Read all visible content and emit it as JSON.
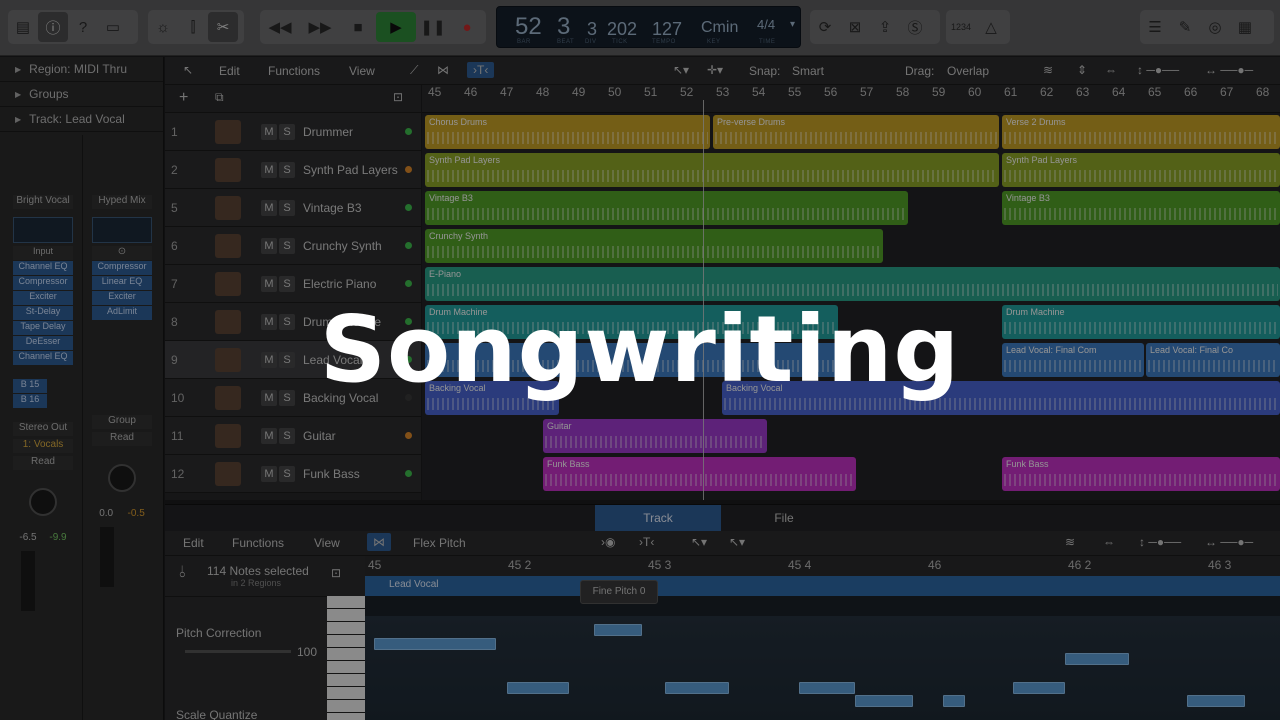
{
  "title": "Songwriting",
  "lcd": {
    "bar": "52",
    "beat": "3",
    "div": "3",
    "tick": "202",
    "tempo": "127",
    "key": "Cmin",
    "time": "4/4",
    "lbl_bar": "BAR",
    "lbl_beat": "BEAT",
    "lbl_div": "DIV",
    "lbl_tick": "TICK",
    "lbl_tempo": "TEMPO",
    "lbl_key": "KEY",
    "lbl_time": "TIME"
  },
  "ctrl": {
    "count_in": "1234"
  },
  "inspector": {
    "region": "Region:",
    "region_val": "MIDI Thru",
    "groups": "Groups",
    "track": "Track:",
    "track_val": "Lead Vocal",
    "strip1": {
      "name": "Bright Vocal",
      "input": "Input",
      "plugins": [
        "Channel EQ",
        "Compressor",
        "Exciter",
        "St-Delay",
        "Tape Delay",
        "DeEsser",
        "Channel EQ"
      ],
      "sends": [
        "B 15",
        "B 16"
      ],
      "out": "Stereo Out",
      "grp": "1: Vocals",
      "auto": "Read",
      "v1": "-6.5",
      "v2": "-9.9"
    },
    "strip2": {
      "name": "Hyped Mix",
      "plugins": [
        "Compressor",
        "Linear EQ",
        "Exciter",
        "AdLimit"
      ],
      "grp": "Group",
      "auto": "Read",
      "v1": "0.0",
      "v2": "-0.5"
    }
  },
  "tracks_toolbar": {
    "edit": "Edit",
    "functions": "Functions",
    "view": "View",
    "snap": "Snap:",
    "snap_val": "Smart",
    "drag": "Drag:",
    "drag_val": "Overlap"
  },
  "ruler": [
    "45",
    "46",
    "47",
    "48",
    "49",
    "50",
    "51",
    "52",
    "53",
    "54",
    "55",
    "56",
    "57",
    "58",
    "59",
    "60",
    "61",
    "62",
    "63",
    "64",
    "65",
    "66",
    "67",
    "68"
  ],
  "tracks": [
    {
      "num": "1",
      "name": "Drummer",
      "dot": "#3fbf4f"
    },
    {
      "num": "2",
      "name": "Synth Pad Layers",
      "dot": "#e08a2a"
    },
    {
      "num": "5",
      "name": "Vintage B3",
      "dot": "#3fbf4f"
    },
    {
      "num": "6",
      "name": "Crunchy Synth",
      "dot": "#3fbf4f"
    },
    {
      "num": "7",
      "name": "Electric Piano",
      "dot": "#3fbf4f"
    },
    {
      "num": "8",
      "name": "Drum Machine",
      "dot": "#3fbf4f"
    },
    {
      "num": "9",
      "name": "Lead Vocal",
      "dot": "#3fbf4f"
    },
    {
      "num": "10",
      "name": "Backing Vocal",
      "dot": "#3a3a3a"
    },
    {
      "num": "11",
      "name": "Guitar",
      "dot": "#e08a2a"
    },
    {
      "num": "12",
      "name": "Funk Bass",
      "dot": "#3fbf4f"
    }
  ],
  "regions": {
    "chorus": "Chorus Drums",
    "preverse": "Pre-verse Drums",
    "verse2": "Verse 2 Drums",
    "pad": "Synth Pad Layers",
    "b3": "Vintage B3",
    "crunchy": "Crunchy Synth",
    "epiano": "E-Piano",
    "drummachine": "Drum Machine",
    "lead1": "Lead Vocal: Final Com",
    "lead2": "Lead Vocal: Final Co",
    "backing": "Backing Vocal",
    "guitar": "Guitar",
    "bass": "Funk Bass"
  },
  "editor": {
    "tab_track": "Track",
    "tab_file": "File",
    "edit": "Edit",
    "functions": "Functions",
    "view": "View",
    "mode": "Flex Pitch",
    "notes_sel": "114 Notes selected",
    "regions": "in 2 Regions",
    "pitch_corr": "Pitch Correction",
    "pc_val": "100",
    "scale_q": "Scale Quantize",
    "region_name": "Lead Vocal",
    "fine_pitch": "Fine Pitch",
    "fine_val": "0",
    "ruler": [
      "45",
      "45 2",
      "45 3",
      "45 4",
      "46",
      "46 2",
      "46 3"
    ]
  },
  "colors": {
    "drums": "#c9a227",
    "pad": "#8fa828",
    "b3": "#53a329",
    "epiano": "#2aa38a",
    "drummachine": "#24a3a1",
    "vocal": "#3f7fc7",
    "backing": "#4a66d6",
    "guitar": "#a03cd0",
    "bass": "#c632c9"
  }
}
